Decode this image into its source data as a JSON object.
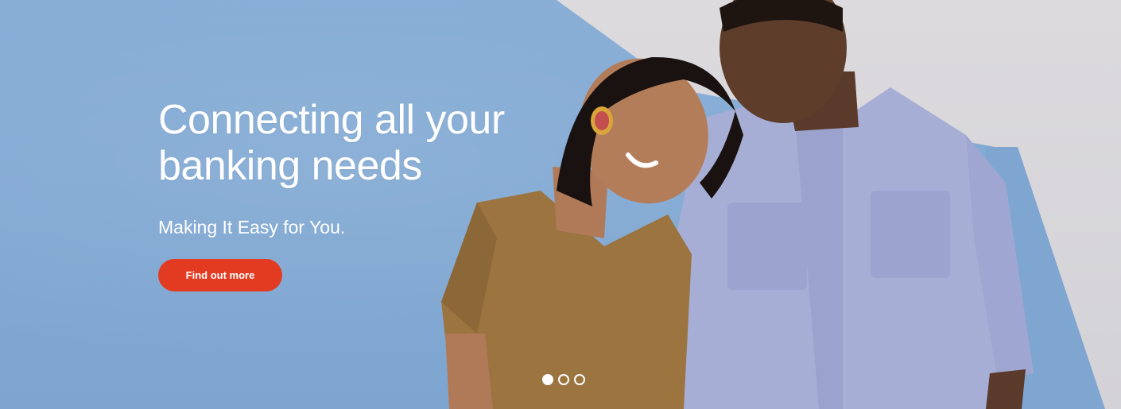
{
  "hero": {
    "headline_line1": "Connecting all your",
    "headline_line2": "banking needs",
    "subheadline": "Making It Easy for You.",
    "cta_label": "Find out more",
    "cta_color": "#e33b22"
  },
  "carousel": {
    "slide_count": 3,
    "active_index": 0
  },
  "colors": {
    "wall_blue": "#84abd5",
    "wall_grey": "#d8d7da",
    "text": "#ffffff"
  }
}
